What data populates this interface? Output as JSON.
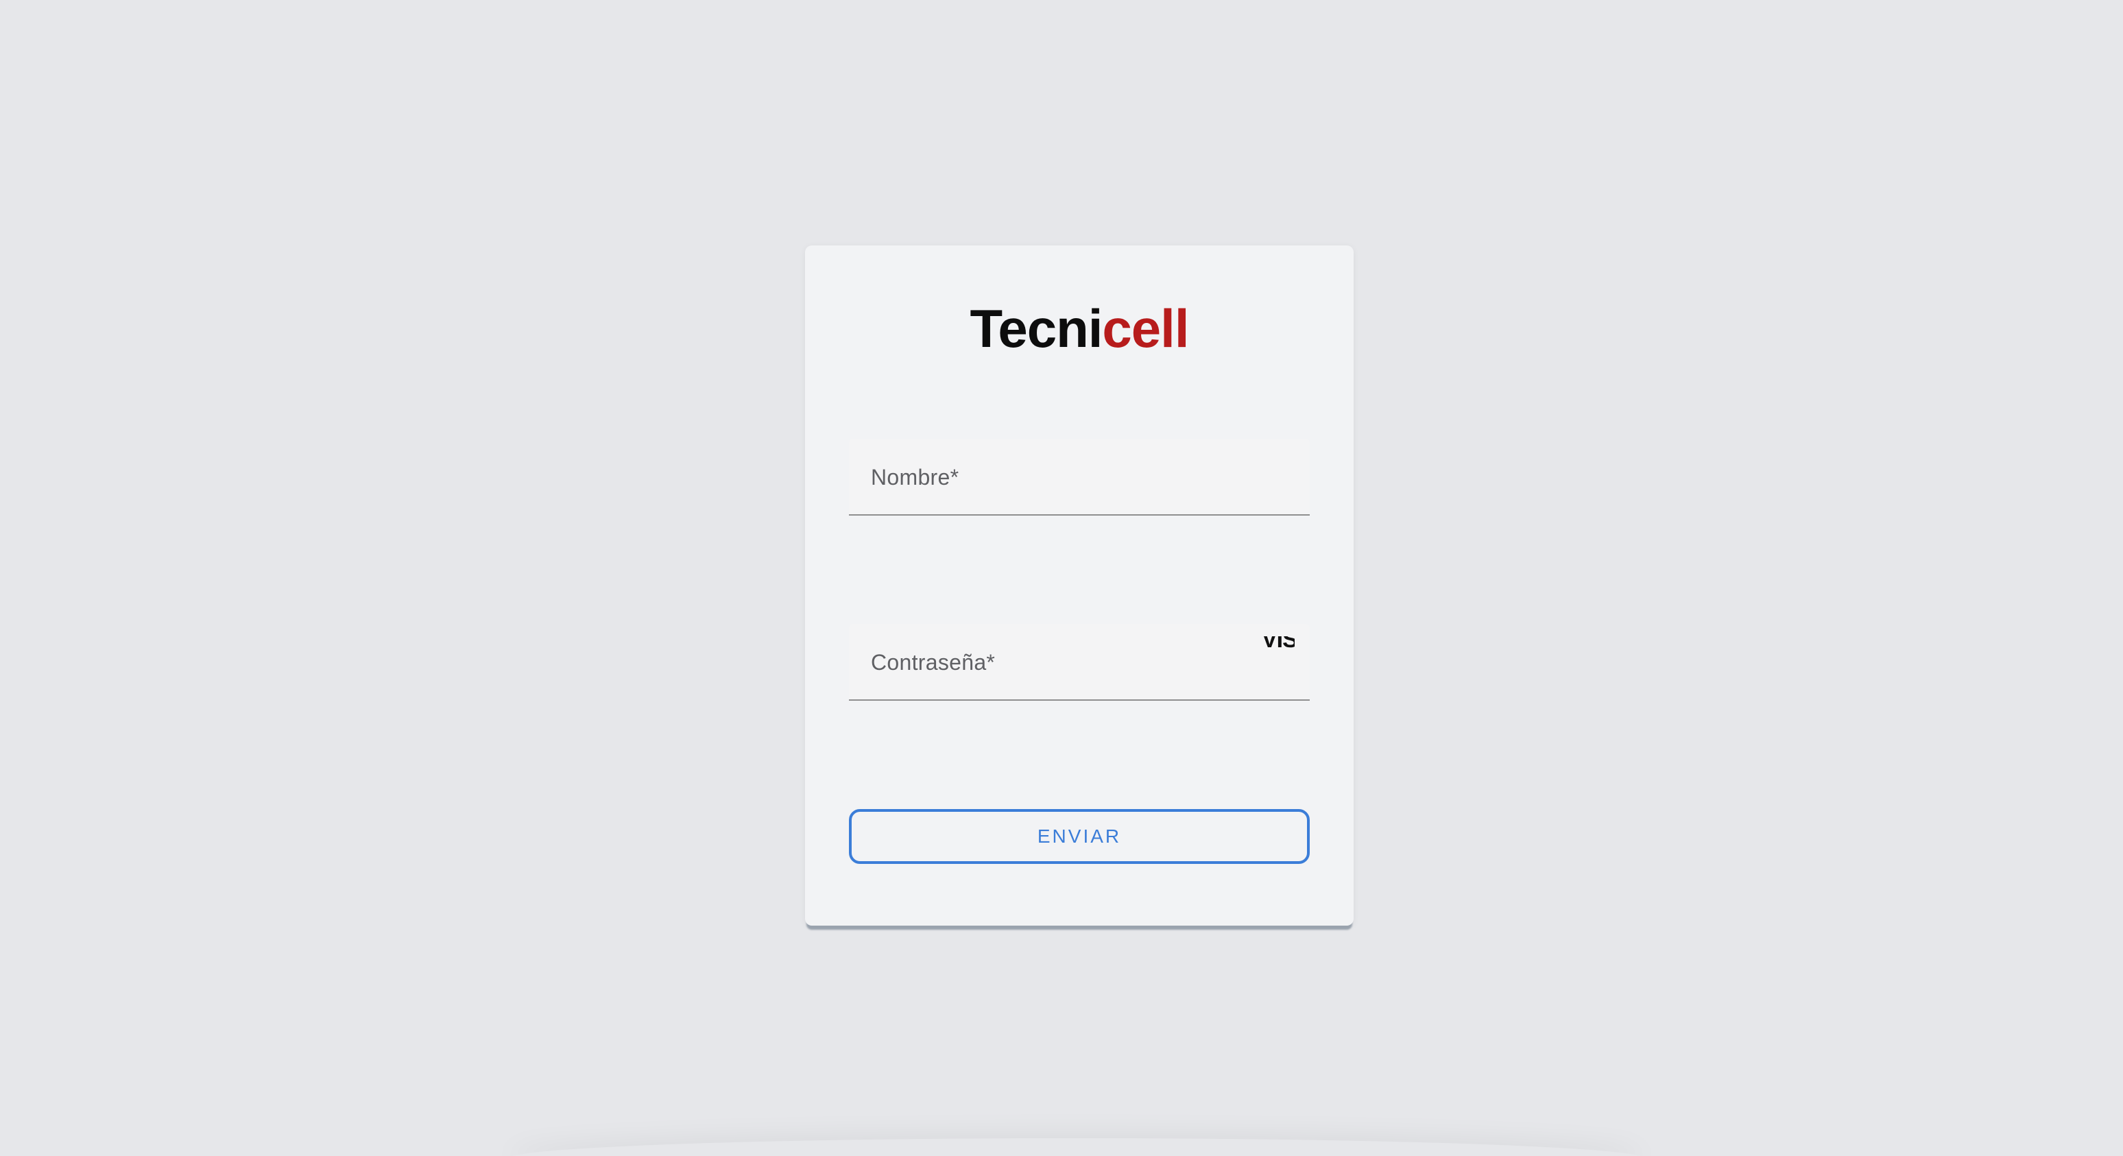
{
  "brand": {
    "name_part1": "Tecni",
    "name_part2": "cell",
    "color_part1": "#0d0d0d",
    "color_part2": "#b71c1c"
  },
  "form": {
    "name_field": {
      "label": "Nombre*",
      "value": ""
    },
    "password_field": {
      "label": "Contraseña*",
      "value": "",
      "toggle_label": "VIS",
      "toggle_icon": "visibility-toggle-icon"
    },
    "submit_label": "ENVIAR"
  },
  "colors": {
    "page_background": "#e6e7ea",
    "card_background": "#f2f3f5",
    "accent": "#3b7dd8"
  }
}
